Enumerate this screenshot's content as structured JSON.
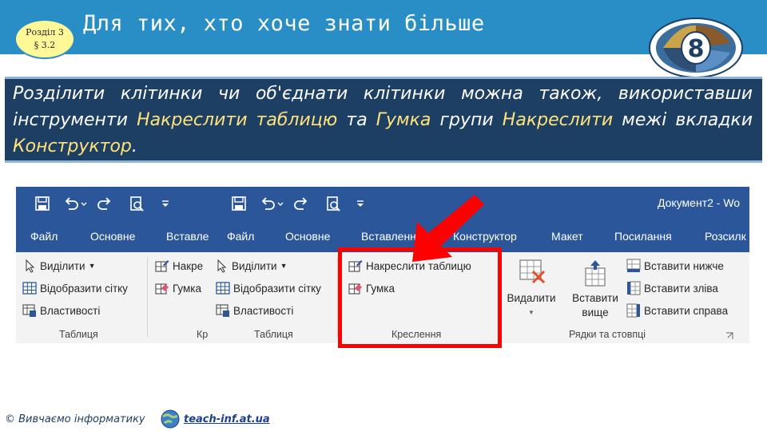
{
  "header": {
    "badge_line1": "Розділ 3",
    "badge_line2": "§ 3.2",
    "title": "Для тих, хто хоче знати більше",
    "grade_number": "8"
  },
  "body_text": {
    "t1": "Розділити клітинки чи об'єднати клітинки можна також, використавши інструменти ",
    "h1": "Накреслити таблицю",
    "t2": " та ",
    "h2": "Гумка",
    "t3": " групи ",
    "h3": "Накреслити",
    "t4": " межі вкладки ",
    "h4": "Конструктор",
    "t5": "."
  },
  "word": {
    "doc_title": "Документ2 - Wo",
    "tabs": [
      "Файл",
      "Основне",
      "Вставле",
      "Файл",
      "Основне",
      "Вставлення",
      "Конструктор",
      "Макет",
      "Посилання",
      "Розсилк"
    ],
    "panel1": {
      "select": "Виділити",
      "gridlines": "Відобразити сітку",
      "properties": "Властивості",
      "group": "Таблиця"
    },
    "panel2": {
      "draw_table": "Накре",
      "eraser": "Гумка",
      "group": "Кр"
    },
    "panel3": {
      "select": "Виділити",
      "gridlines": "Відобразити сітку",
      "properties": "Властивості",
      "group": "Таблиця"
    },
    "draw": {
      "draw_table": "Накреслити таблицю",
      "eraser": "Гумка",
      "group": "Креслення"
    },
    "rows_cols": {
      "delete_line1": "Видалити",
      "insert_above_line1": "Вставити",
      "insert_above_line2": "вище",
      "insert_below": "Вставити нижче",
      "insert_left": "Вставити зліва",
      "insert_right": "Вставити справа",
      "group": "Рядки та стовпці"
    }
  },
  "footer": {
    "copyright": "© Вивчаємо інформатику",
    "site": "teach-inf.at.ua"
  },
  "colors": {
    "header_blue": "#2a8ec6",
    "textbox_navy": "#1c3f63",
    "highlight_yellow": "#ffe27a",
    "word_blue": "#2b579a",
    "annotation_red": "#ff0000"
  }
}
